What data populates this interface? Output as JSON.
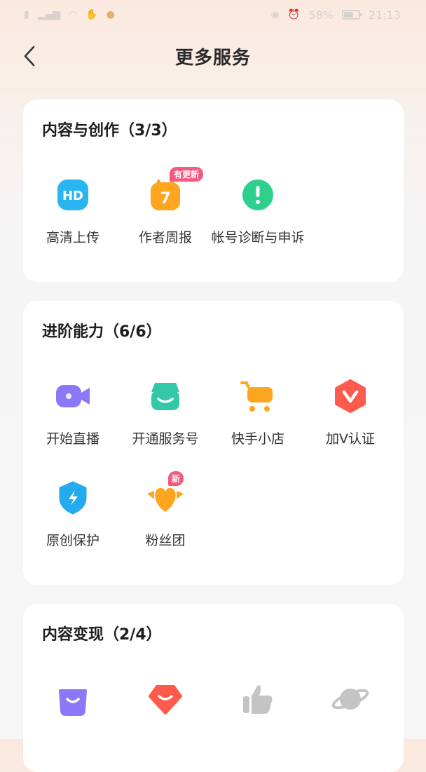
{
  "status_bar": {
    "left_icons": [
      "sim-icon",
      "signal-icon",
      "wifi-icon",
      "hand-icon",
      "app-notification-icon"
    ],
    "battery": "58%",
    "time": "21:13"
  },
  "header": {
    "title": "更多服务"
  },
  "sections": [
    {
      "title": "内容与创作（3/3）",
      "items": [
        {
          "label": "高清上传",
          "icon": "hd-icon",
          "color": "#29b6f0"
        },
        {
          "label": "作者周报",
          "icon": "weekly-report-icon",
          "color": "#ffa51f",
          "badge": "有更新"
        },
        {
          "label": "帐号诊断与申诉",
          "icon": "exclamation-icon",
          "color": "#2ed08e"
        }
      ]
    },
    {
      "title": "进阶能力（6/6）",
      "items": [
        {
          "label": "开始直播",
          "icon": "video-camera-icon",
          "color": "#8c78f7"
        },
        {
          "label": "开通服务号",
          "icon": "store-icon",
          "color": "#33c9a8"
        },
        {
          "label": "快手小店",
          "icon": "cart-icon",
          "color": "#ffa51f"
        },
        {
          "label": "加V认证",
          "icon": "v-badge-icon",
          "color": "#ff5a4e"
        },
        {
          "label": "原创保护",
          "icon": "shield-icon",
          "color": "#25a9ef"
        },
        {
          "label": "粉丝团",
          "icon": "heart-icon",
          "color": "#ffa51f",
          "badge": "新"
        }
      ]
    },
    {
      "title": "内容变现（2/4）",
      "items": [
        {
          "label": "",
          "icon": "shopping-bag-icon",
          "color": "#8c78f7"
        },
        {
          "label": "",
          "icon": "smile-badge-icon",
          "color": "#ff5a4e"
        },
        {
          "label": "",
          "icon": "thumbs-up-icon",
          "color": "#c4c4c4"
        },
        {
          "label": "",
          "icon": "planet-icon",
          "color": "#c4c4c4"
        }
      ]
    }
  ]
}
